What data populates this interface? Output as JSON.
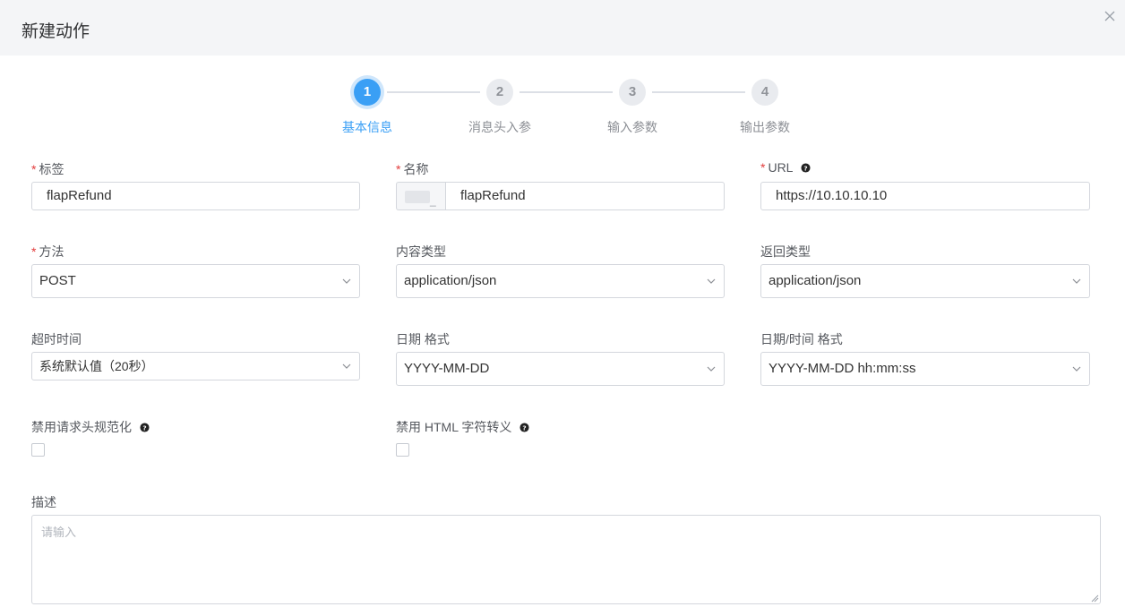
{
  "dialog": {
    "title": "新建动作"
  },
  "steps": [
    {
      "number": "1",
      "label": "基本信息",
      "active": true
    },
    {
      "number": "2",
      "label": "消息头入参",
      "active": false
    },
    {
      "number": "3",
      "label": "输入参数",
      "active": false
    },
    {
      "number": "4",
      "label": "输出参数",
      "active": false
    }
  ],
  "form": {
    "tag": {
      "label": "标签",
      "value": "flapRefund"
    },
    "name": {
      "label": "名称",
      "prefix": "_",
      "value": "flapRefund"
    },
    "url": {
      "label": "URL",
      "value": "https://10.10.10.10"
    },
    "method": {
      "label": "方法",
      "value": "POST"
    },
    "content_type": {
      "label": "内容类型",
      "value": "application/json"
    },
    "return_type": {
      "label": "返回类型",
      "value": "application/json"
    },
    "timeout": {
      "label": "超时时间",
      "value": "系统默认值（20秒）"
    },
    "date_format": {
      "label": "日期 格式",
      "value": "YYYY-MM-DD"
    },
    "datetime_format": {
      "label": "日期/时间 格式",
      "value": "YYYY-MM-DD hh:mm:ss"
    },
    "disable_header_normalize": {
      "label": "禁用请求头规范化",
      "checked": false
    },
    "disable_html_escape": {
      "label": "禁用 HTML 字符转义",
      "checked": false
    },
    "description": {
      "label": "描述",
      "placeholder": "请输入"
    }
  },
  "required_mark": "*",
  "colors": {
    "accent": "#3a9ff5",
    "required": "#e23c3c"
  },
  "icons": {
    "close": "close-icon",
    "help": "question-circle-icon",
    "dropdown": "chevron-down-icon"
  }
}
